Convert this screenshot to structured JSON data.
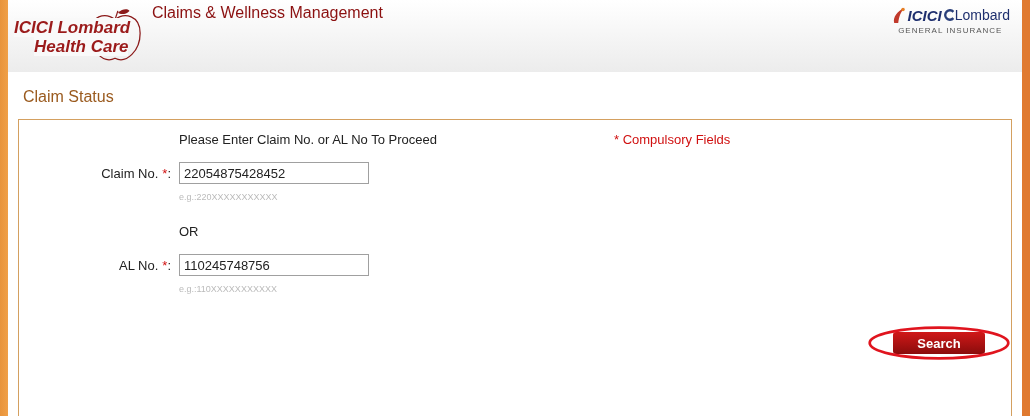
{
  "header": {
    "logo_line_1": "ICICI Lombard",
    "logo_line_2": "Health Care",
    "title": "Claims & Wellness Management",
    "brand_mark": "ICICI",
    "brand_name": "Lombard",
    "brand_tagline": "GENERAL INSURANCE"
  },
  "page_title": "Claim Status",
  "form": {
    "instruction": "Please Enter Claim No. or AL No To Proceed",
    "compulsory_note": "* Compulsory Fields",
    "fields": [
      {
        "label": "Claim No.",
        "required_mark": "*",
        "colon": ":",
        "value": "22054875428452",
        "hint": "e.g.:220XXXXXXXXXXX"
      },
      {
        "label": "AL No.",
        "required_mark": "*",
        "colon": ":",
        "value": "110245748756",
        "hint": "e.g.:110XXXXXXXXXXX"
      }
    ],
    "separator": "OR",
    "button": {
      "label": "Search",
      "circled": true
    }
  }
}
